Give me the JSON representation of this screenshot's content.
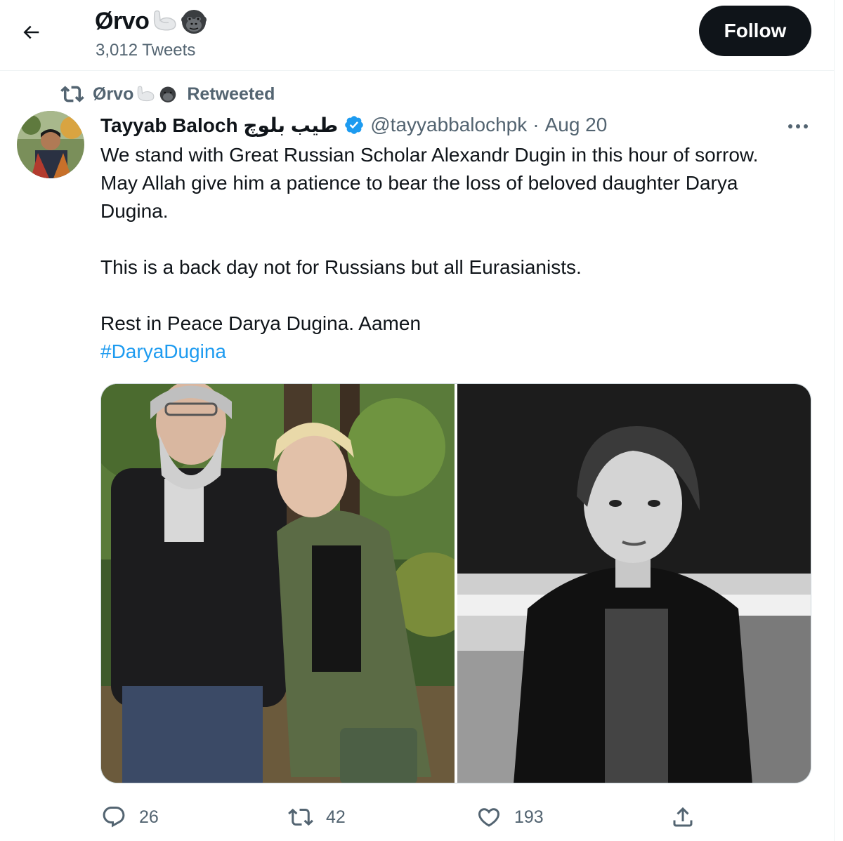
{
  "header": {
    "profile_name": "Ørvo",
    "tweets_count": "3,012 Tweets",
    "follow_label": "Follow"
  },
  "retweet": {
    "retweeter": "Ørvo",
    "label": "Retweeted"
  },
  "tweet": {
    "author_name": "Tayyab Baloch طیب بلوچ",
    "handle": "@tayyabbalochpk",
    "separator": "·",
    "date": "Aug 20",
    "lines": [
      "We stand with Great Russian Scholar Alexandr Dugin in this hour of sorrow.",
      "May Allah give him a patience to bear the loss of beloved daughter Darya",
      "Dugina.",
      "",
      "This is a back day not for Russians but all Eurasianists.",
      "",
      "Rest in Peace Darya Dugina. Aamen"
    ],
    "hashtag": "#DaryaDugina"
  },
  "stats": {
    "replies": "26",
    "retweets": "42",
    "likes": "193"
  },
  "icons": {
    "back": "arrow-left-icon",
    "retweet": "retweet-icon",
    "verified": "verified-badge-icon",
    "more": "more-dots-icon",
    "reply": "reply-icon",
    "like": "heart-icon",
    "share": "share-icon"
  },
  "colors": {
    "accent": "#1d9bf0",
    "text": "#0f1419",
    "secondary": "#536471",
    "follow_bg": "#0f1419"
  }
}
